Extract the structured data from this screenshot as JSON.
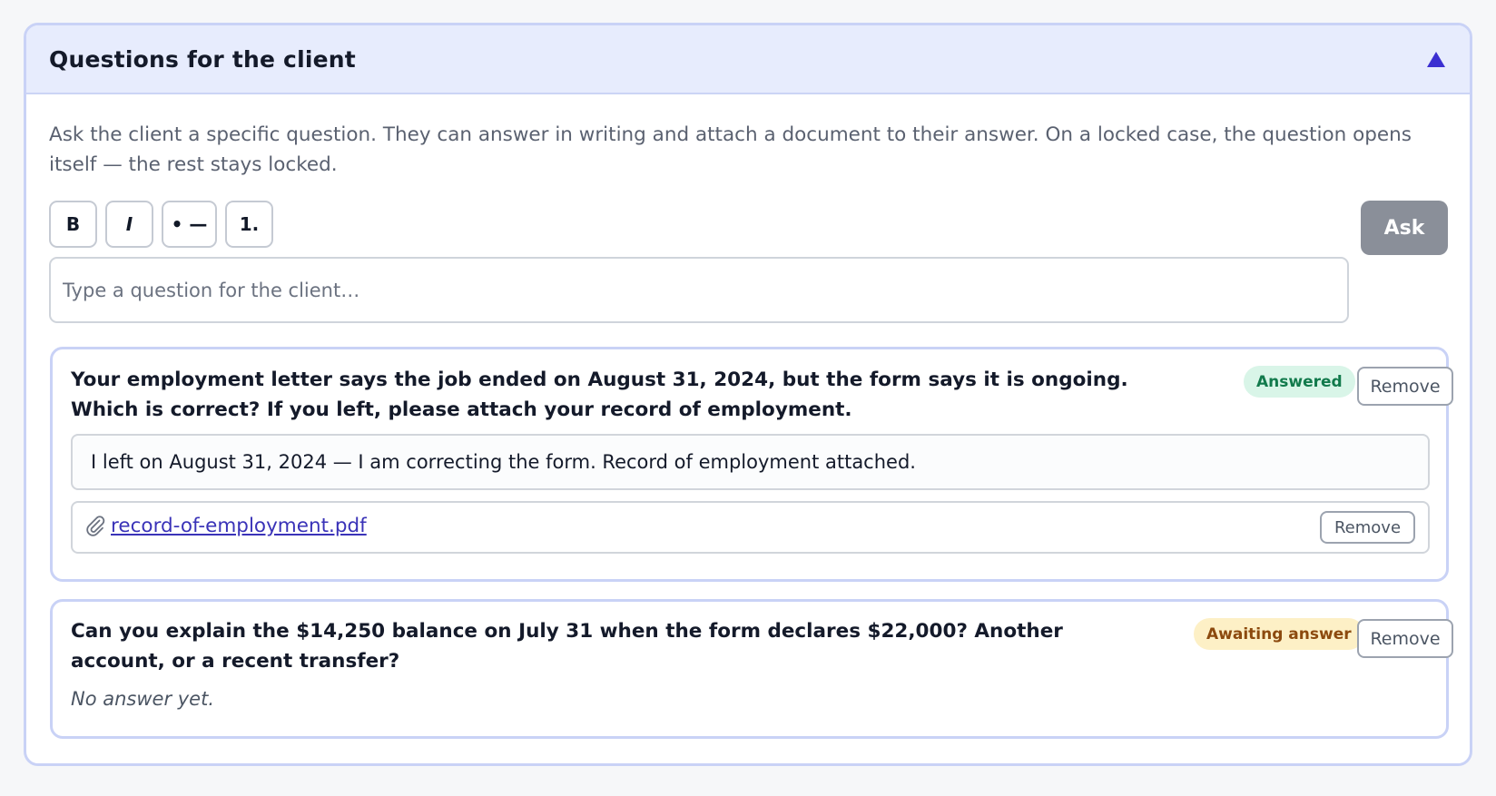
{
  "panel": {
    "title": "Questions for the client",
    "description": "Ask the client a specific question. They can answer in writing and attach a document to their answer. On a locked case, the question opens itself — the rest stays locked."
  },
  "toolbar": {
    "bold": "B",
    "italic": "I",
    "bullets": "• —",
    "numbered": "1.",
    "ask_label": "Ask"
  },
  "input": {
    "placeholder": "Type a question for the client…"
  },
  "questions": [
    {
      "text_before": "Your employment letter says the job ended on ",
      "text_bold": "August 31, 2024",
      "text_after": ", but the form says it is ongoing. Which is correct? If you left, please attach your record of employment.",
      "status": "Answered",
      "remove_label": "Remove",
      "answer": "I left on August 31, 2024 — I am correcting the form. Record of employment attached.",
      "attachment": {
        "name": "record-of-employment.pdf",
        "remove_label": "Remove"
      }
    },
    {
      "text_before": "Can you explain the ",
      "text_bold": "$14,250",
      "text_after": " balance on July 31 when the form declares $22,000? Another account, or a recent transfer?",
      "status": "Awaiting answer",
      "remove_label": "Remove",
      "empty_answer": "No answer yet."
    }
  ],
  "colors": {
    "accent": "#3b2fd1",
    "header_bg": "#e7ecfd",
    "answered_bg": "#d9f5e8",
    "answered_text": "#127a4c",
    "awaiting_bg": "#fdf0c6",
    "awaiting_text": "#8c4a0e"
  },
  "icons": [
    "collapse-triangle-icon",
    "paperclip-icon"
  ]
}
